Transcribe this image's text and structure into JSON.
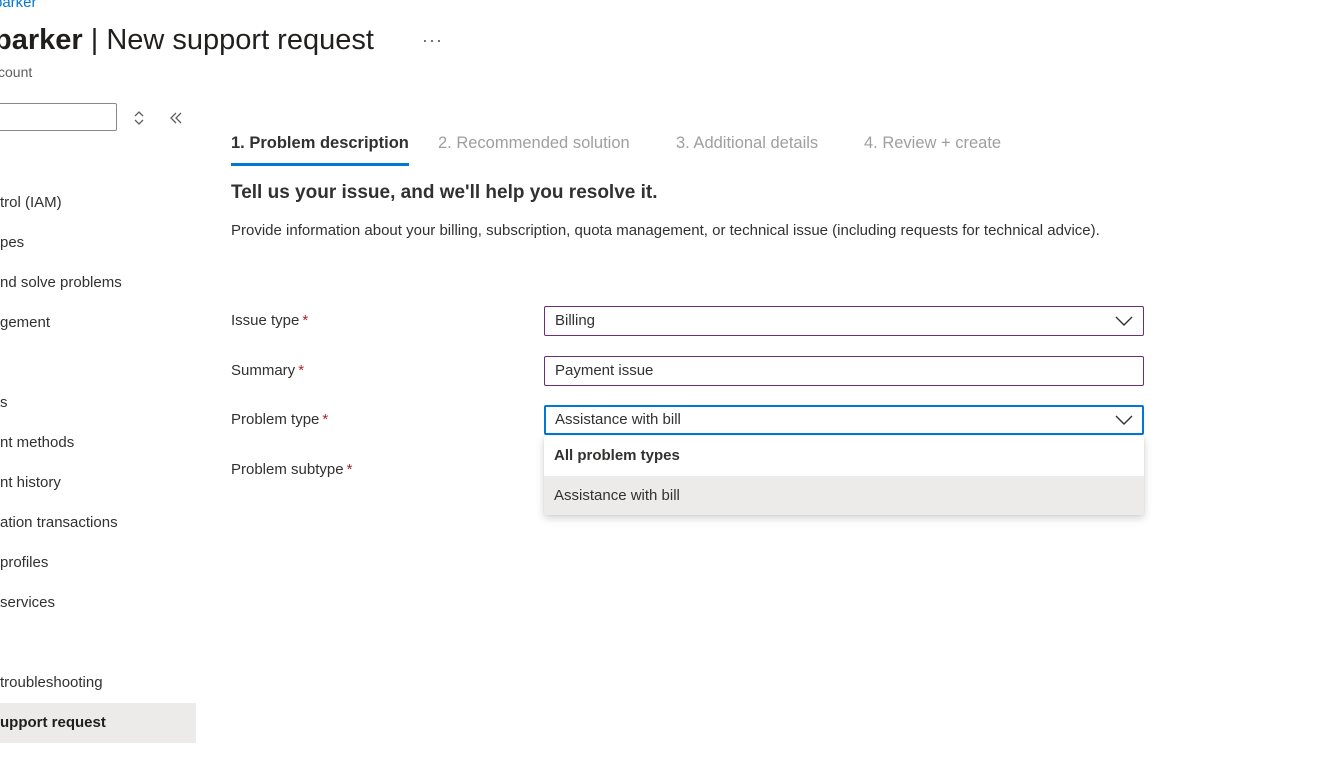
{
  "breadcrumb": {
    "text": "parker"
  },
  "header": {
    "resource_name": "parker",
    "separator": " | ",
    "title": "New support request",
    "more_label": "···",
    "subtitle": "count"
  },
  "sidebar": {
    "search_value": "",
    "items": [
      {
        "label": "trol (IAM)"
      },
      {
        "label": "pes"
      },
      {
        "label": "nd solve problems"
      },
      {
        "label": "gement"
      },
      {
        "label": "s"
      },
      {
        "label": "nt methods"
      },
      {
        "label": "nt history"
      },
      {
        "label": "ation transactions"
      },
      {
        "label": "profiles"
      },
      {
        "label": " services"
      },
      {
        "label": "troubleshooting"
      },
      {
        "label": "upport request"
      }
    ]
  },
  "tabs": [
    {
      "label": "1. Problem description",
      "active": true
    },
    {
      "label": "2. Recommended solution",
      "active": false
    },
    {
      "label": "3. Additional details",
      "active": false
    },
    {
      "label": "4. Review + create",
      "active": false
    }
  ],
  "main": {
    "section_title": "Tell us your issue, and we'll help you resolve it.",
    "section_desc": "Provide information about your billing, subscription, quota management, or technical issue (including requests for technical advice).",
    "fields": {
      "issue_type": {
        "label": "Issue type",
        "required_mark": "*",
        "value": "Billing"
      },
      "summary": {
        "label": "Summary",
        "required_mark": "*",
        "value": "Payment issue"
      },
      "problem_type": {
        "label": "Problem type",
        "required_mark": "*",
        "value": "Assistance with bill"
      },
      "problem_subtype": {
        "label": "Problem subtype",
        "required_mark": "*"
      }
    },
    "dropdown": {
      "header": "All problem types",
      "options": [
        {
          "label": "Assistance with bill"
        }
      ]
    }
  },
  "colors": {
    "accent": "#0078d4",
    "required": "#a4262c",
    "field_border": "#6b2d7f",
    "selected_bg": "#edebe9",
    "inactive_tab": "#a19f9d"
  },
  "icons": {
    "more": "more-icon",
    "updown": "sort-updown-icon",
    "collapse": "double-chevron-left-icon",
    "dropdown": "chevron-down-icon"
  }
}
